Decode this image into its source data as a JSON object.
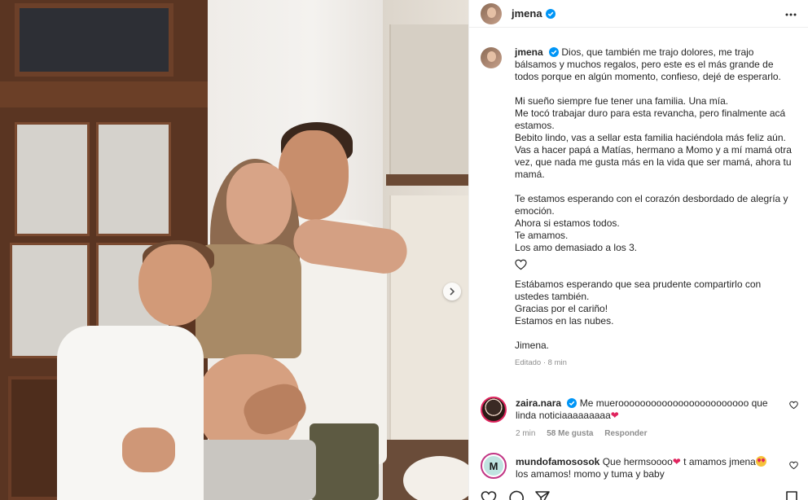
{
  "post": {
    "username": "jmena",
    "carousel_next_icon": "chevron-right-icon",
    "more_icon": "more-horizontal-icon"
  },
  "caption": {
    "username": "jmena",
    "paragraphs": [
      "Dios, que también me trajo dolores, me trajo bálsamos y muchos regalos, pero este es el más grande de todos porque en algún momento, confieso, dejé de esperarlo.",
      "",
      "Mi sueño siempre fue tener una familia. Una mía.",
      "Me tocó trabajar duro para esta revancha, pero finalmente acá estamos.",
      "Bebito lindo, vas a sellar esta familia haciéndola más feliz aún.",
      "Vas a hacer papá a Matías, hermano a Momo y a mí mamá otra vez, que nada me gusta más en la vida que ser mamá, ahora tu mamá.",
      "",
      "Te estamos esperando con el corazón desbordado de alegría y emoción.",
      "Ahora si estamos todos.",
      "Te amamos.",
      "Los amo demasiado a los 3."
    ],
    "heart_icon": "heart-outline-icon",
    "paragraphs2": [
      "Estábamos esperando que sea prudente compartirlo con ustedes también.",
      "Gracias por el cariño!",
      "Estamos en las nubes.",
      "",
      "Jimena."
    ],
    "meta": "Editado · 8 min"
  },
  "comments": [
    {
      "username": "zaira.nara",
      "verified": true,
      "text": "Me mueroooooooooooooooooooooooo que linda noticiaaaaaaaaa",
      "emoji": "❤",
      "time": "2 min",
      "likes": "58 Me gusta",
      "reply": "Responder"
    },
    {
      "username": "mundofamososok",
      "avatar_letter": "M",
      "text_a": "Que hermsoooo",
      "text_b": " t amamos jmena",
      "text_c": " los amamos! momo y tuma y baby",
      "emoji": "❤"
    }
  ],
  "actions": {
    "like_icon": "heart-icon",
    "comment_icon": "comment-icon",
    "share_icon": "send-icon",
    "save_icon": "bookmark-icon"
  },
  "colors": {
    "verified": "#0095f6",
    "text": "#262626",
    "muted": "#8e8e8e",
    "heart": "#e0245e"
  }
}
